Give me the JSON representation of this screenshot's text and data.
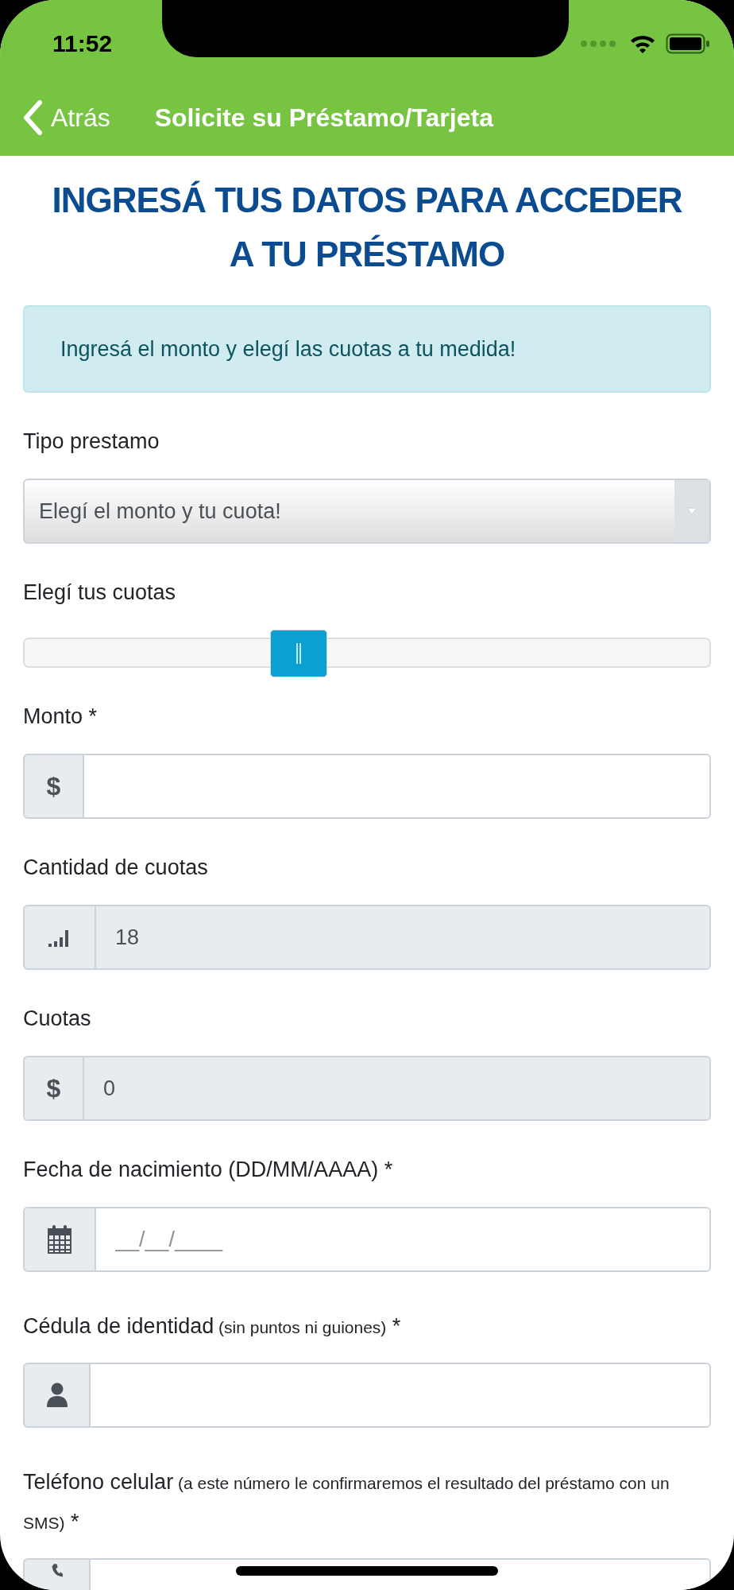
{
  "status_bar": {
    "time": "11:52"
  },
  "nav": {
    "back": "Atrás",
    "title": "Solicite su Préstamo/Tarjeta"
  },
  "heading": "INGRESÁ TUS DATOS PARA ACCEDER A TU PRÉSTAMO",
  "alert": "Ingresá el monto y elegí las cuotas a tu medida!",
  "fields": [
    {
      "kind": "select",
      "label": "Tipo prestamo",
      "value": "Elegí el monto y tu cuota!"
    },
    {
      "kind": "slider",
      "label": "Elegí tus cuotas",
      "level": 0.4
    },
    {
      "kind": "currency",
      "label": "Monto",
      "required_mark": "*",
      "addon": "$",
      "disabled": false
    },
    {
      "kind": "count",
      "label": "Cantidad de cuotas",
      "value": "18",
      "disabled": true
    },
    {
      "kind": "currency",
      "label": "Cuotas",
      "addon": "$",
      "value": "0",
      "disabled": true
    },
    {
      "kind": "date",
      "label": "Fecha de nacimiento (DD/MM/AAAA)",
      "required_mark": "*",
      "placeholder": "__/__/____",
      "disabled": false
    },
    {
      "kind": "id",
      "label": "Cédula de identidad",
      "note": "(sin puntos ni guiones)",
      "required_mark": "*",
      "disabled": false
    },
    {
      "kind": "phone",
      "label": "Teléfono celular",
      "note": "(a este número le confirmaremos el resultado del préstamo con un SMS)",
      "required_mark": "*",
      "disabled": false
    }
  ]
}
